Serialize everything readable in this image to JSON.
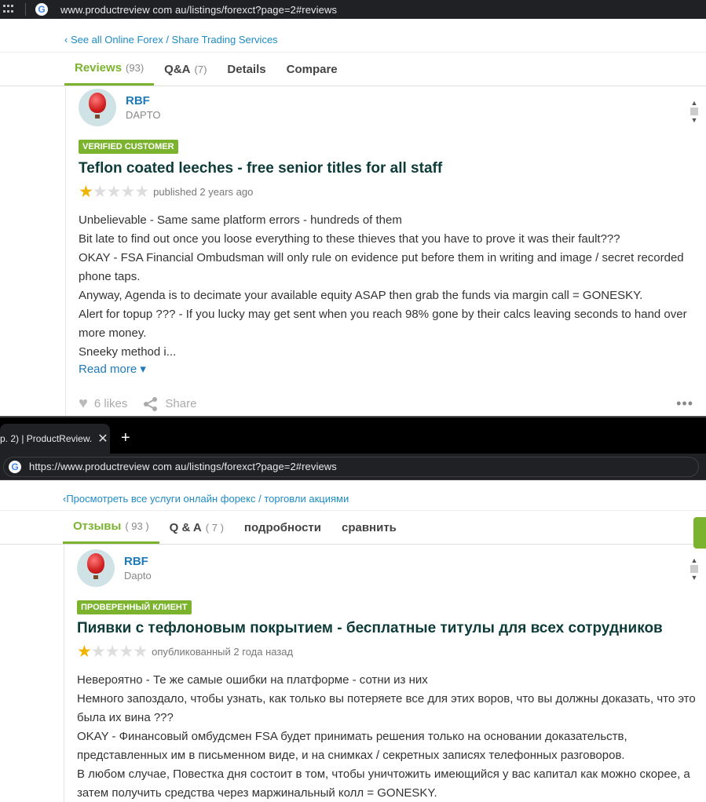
{
  "top": {
    "url": "www.productreview com au/listings/forexct?page=2#reviews",
    "back_link": "‹ See all Online Forex / Share Trading Services",
    "tabs": [
      {
        "label": "Reviews",
        "count": "(93)"
      },
      {
        "label": "Q&A",
        "count": "(7)"
      },
      {
        "label": "Details",
        "count": ""
      },
      {
        "label": "Compare",
        "count": ""
      }
    ],
    "review": {
      "name": "RBF",
      "location": "DAPTO",
      "badge": "VERIFIED CUSTOMER",
      "title": "Teflon coated leeches - free senior titles for all staff",
      "rating": 1,
      "published": "published 2 years ago",
      "lines": [
        "Unbelievable - Same same platform errors - hundreds of them",
        "Bit late to find out once you loose everything to these thieves that you have to prove it was their fault???",
        "OKAY - FSA Financial Ombudsman will only rule on evidence put before them in writing and image / secret recorded phone taps.",
        "Anyway, Agenda is to decimate your available equity ASAP then grab the funds via margin call = GONESKY.",
        "Alert for topup ??? - If you lucky may get sent when you reach 98% gone by their calcs leaving seconds to hand over more money.",
        "Sneeky method i..."
      ],
      "read_more": "Read more ▾",
      "likes": "6 likes",
      "share": "Share"
    }
  },
  "bottom": {
    "tab_title": "р. 2) | ProductReview.",
    "tab_close": "✕",
    "new_tab": "+",
    "url": "https://www.productreview com au/listings/forexct?page=2#reviews",
    "back_link": "‹Просмотреть все услуги онлайн форекс / торговли акциями",
    "tabs": [
      {
        "label": "Отзывы",
        "count": "( 93 )"
      },
      {
        "label": "Q & A",
        "count": "( 7 )"
      },
      {
        "label": "подробности",
        "count": ""
      },
      {
        "label": "сравнить",
        "count": ""
      }
    ],
    "review": {
      "name": "RBF",
      "location": "Dapto",
      "badge": "ПРОВЕРЕННЫЙ КЛИЕНТ",
      "title": "Пиявки с тефлоновым покрытием - бесплатные титулы для всех сотрудников",
      "rating": 1,
      "published": "опубликованный 2 года назад",
      "lines": [
        "Невероятно - Те же самые ошибки на платформе - сотни из них",
        "Немного запоздало, чтобы узнать, как только вы потеряете все для этих воров, что вы должны доказать, что это была их вина ???",
        "OKAY - Финансовый омбудсмен FSA будет принимать решения только на основании доказательств, представленных им в письменном виде, и на снимках / секретных записях телефонных разговоров.",
        "В любом случае, Повестка дня состоит в том, чтобы уничтожить имеющийся у вас капитал как можно скорее, а затем получить средства через маржинальный колл = GONESKY."
      ]
    }
  },
  "icons": {
    "google": "G",
    "star": "★",
    "heart": "♥",
    "more": "•••",
    "up": "▲",
    "down": "▼"
  },
  "colors": {
    "accent_green": "#7bb32e",
    "link_blue": "#1e7ab8",
    "title_dark": "#0d3b3a",
    "star_gold": "#f0b400"
  }
}
